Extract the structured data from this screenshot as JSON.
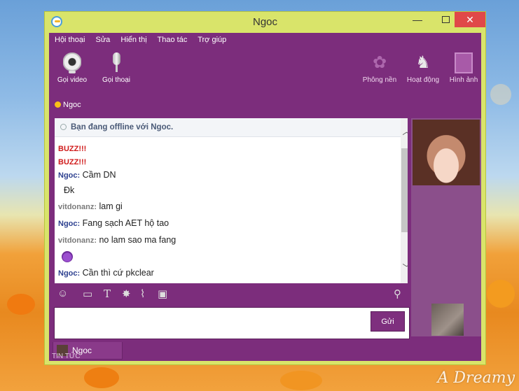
{
  "window": {
    "title": "Ngoc",
    "minimize_symbol": "—",
    "close_symbol": "✕"
  },
  "menu": [
    "Hội thoại",
    "Sửa",
    "Hiển thị",
    "Thao tác",
    "Trợ giúp"
  ],
  "toolbar": {
    "left": [
      {
        "label": "Gọi video",
        "icon": "webcam-icon"
      },
      {
        "label": "Gọi thoại",
        "icon": "microphone-icon"
      }
    ],
    "right": [
      {
        "label": "Phông nền",
        "icon": "wallpaper-icon"
      },
      {
        "label": "Hoạt động",
        "icon": "activity-icon"
      },
      {
        "label": "Hình ảnh",
        "icon": "photos-icon"
      }
    ]
  },
  "contact": {
    "name": "Ngoc",
    "status_color": "#f8c018"
  },
  "chat": {
    "offline_notice": "Bạn đang offline với Ngoc.",
    "messages": [
      {
        "sender": "",
        "text": "BUZZ!!!",
        "type": "buzz"
      },
      {
        "sender": "",
        "text": "BUZZ!!!",
        "type": "buzz"
      },
      {
        "sender": "Ngoc:",
        "text": " Cầm DN",
        "type": "friend"
      },
      {
        "sender": "",
        "text": "Đk",
        "type": "continuation"
      },
      {
        "sender": "vitdonanz:",
        "text": " lam gi",
        "type": "me"
      },
      {
        "sender": "Ngoc:",
        "text": " Fang sạch AET hộ tao",
        "type": "friend"
      },
      {
        "sender": "vitdonanz:",
        "text": " no lam sao ma fang",
        "type": "me"
      },
      {
        "sender": "",
        "text": "",
        "type": "emoticon",
        "icon": "devil-emoticon-icon"
      },
      {
        "sender": "Ngoc:",
        "text": " Cần thì cứ pkclear",
        "type": "friend"
      }
    ]
  },
  "composer": {
    "send_label": "Gửi",
    "value": ""
  },
  "tabs": [
    {
      "label": "Ngoc"
    }
  ],
  "footer": {
    "news_label": "TIN TỨC"
  },
  "wallpaper_signature": "A Dreamy",
  "colors": {
    "frame": "#d9e46a",
    "client": "#7c2d7c",
    "close": "#e04848",
    "buzz": "#d01a1a"
  }
}
